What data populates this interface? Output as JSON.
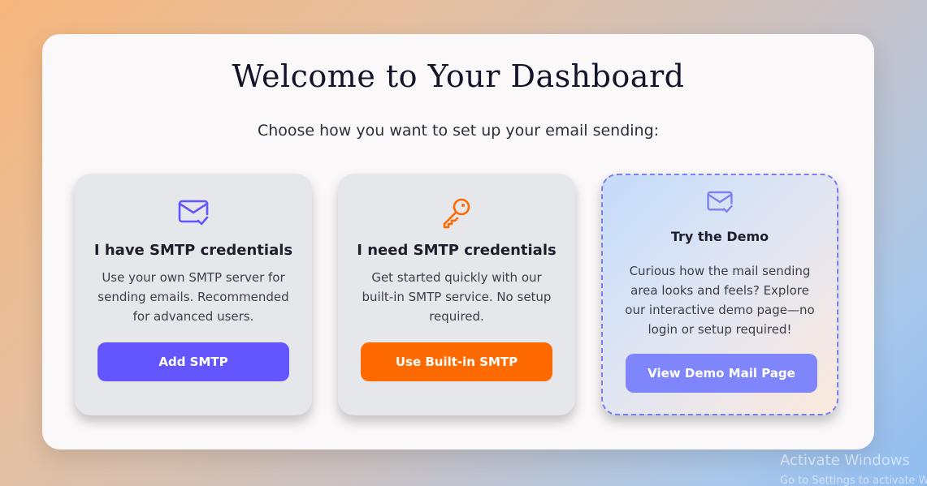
{
  "header": {
    "title": "Welcome to Your Dashboard",
    "subtitle": "Choose how you want to set up your email sending:"
  },
  "cards": [
    {
      "icon": "mail-check-icon",
      "title": "I have SMTP credentials",
      "description": "Use your own SMTP server for sending emails. Recommended for advanced users.",
      "button_label": "Add SMTP",
      "button_color": "#6456ff"
    },
    {
      "icon": "key-icon",
      "title": "I need SMTP credentials",
      "description": "Get started quickly with our built-in SMTP service. No setup required.",
      "button_label": "Use Built-in SMTP",
      "button_color": "#ff6a00"
    },
    {
      "icon": "mail-check-icon",
      "title": "Try the Demo",
      "description": "Curious how the mail sending area looks and feels? Explore our interactive demo page—no login or setup required!",
      "button_label": "View Demo Mail Page",
      "button_color": "#7f86fb"
    }
  ],
  "watermark": {
    "line1": "Activate Windows",
    "line2": "Go to Settings to activate Windows."
  },
  "colors": {
    "accent_purple": "#6456ff",
    "accent_orange": "#ff6a00",
    "demo_border": "#7c7ff0"
  }
}
